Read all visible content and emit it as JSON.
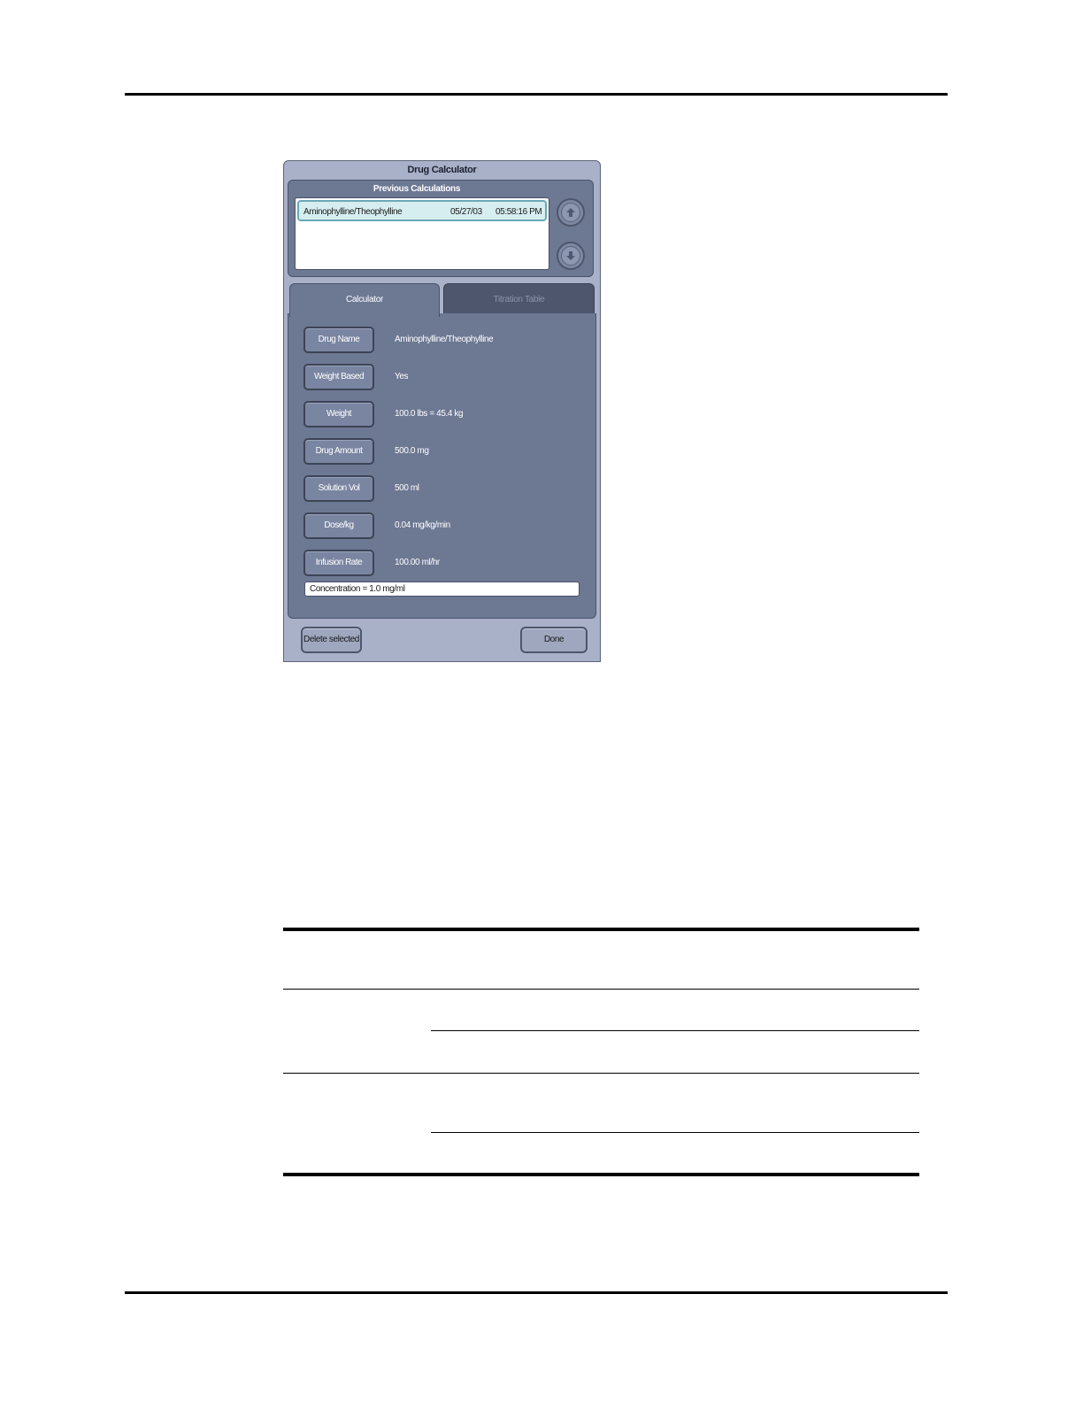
{
  "dialog": {
    "title": "Drug Calculator",
    "previous": {
      "title": "Previous Calculations",
      "rows": [
        {
          "name": "Aminophylline/Theophylline",
          "date": "05/27/03",
          "time": "05:58:16 PM"
        }
      ]
    },
    "tabs": {
      "calculator": "Calculator",
      "titration": "Titration Table"
    },
    "fields": [
      {
        "label": "Drug Name",
        "value": "Aminophylline/Theophylline"
      },
      {
        "label": "Weight Based",
        "value": "Yes"
      },
      {
        "label": "Weight",
        "value": "100.0 lbs = 45.4 kg"
      },
      {
        "label": "Drug Amount",
        "value": "500.0 mg"
      },
      {
        "label": "Solution Vol",
        "value": "500 ml"
      },
      {
        "label": "Dose/kg",
        "value": "0.04 mg/kg/min"
      },
      {
        "label": "Infusion Rate",
        "value": "100.00 ml/hr"
      }
    ],
    "concentration": "Concentration = 1.0  mg/ml",
    "buttons": {
      "delete": "Delete selected",
      "done": "Done"
    },
    "colors": {
      "panel": "#6d7893",
      "frame": "#a9b1c8",
      "selected_row": "#d6eef0"
    }
  }
}
